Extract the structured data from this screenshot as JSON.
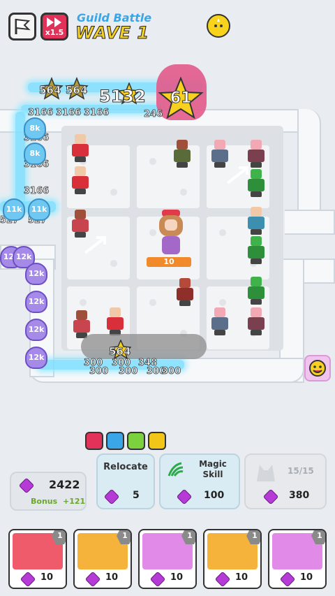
{
  "header": {
    "speed_label": "x1.5",
    "mode_label": "Guild Battle",
    "wave_label": "WAVE 1"
  },
  "boss": {
    "score": "5132",
    "star_value": "61",
    "mini_stars": [
      "564",
      "564"
    ]
  },
  "damage_numbers": {
    "top_row": [
      "3166",
      "3166",
      "3166",
      "246"
    ],
    "left_col": [
      "3166",
      "3166",
      "3166"
    ],
    "lower": [
      "527",
      "527"
    ],
    "bottom_row": [
      "300",
      "300",
      "300",
      "348",
      "300",
      "300",
      "300"
    ],
    "bottom_star": "564"
  },
  "enemies": [
    "12k",
    "12k",
    "12k",
    "12k",
    "12k",
    "12k",
    "11k",
    "11k",
    "8k",
    "8k"
  ],
  "center_unit_level": "10",
  "resources": {
    "gems": "2422",
    "bonus_label": "Bonus",
    "bonus_value": "+121"
  },
  "actions": {
    "relocate": {
      "label": "Relocate",
      "cost": "5"
    },
    "magic_skill": {
      "label": "Magic\nSkill",
      "cost": "100"
    },
    "summon": {
      "count": "15/15",
      "cost": "380"
    }
  },
  "unit_cards": [
    {
      "level": "1",
      "cost": "10",
      "color": "#ef5b6b"
    },
    {
      "level": "1",
      "cost": "10",
      "color": "#f6b33b"
    },
    {
      "level": "1",
      "cost": "10",
      "color": "#e28ae8"
    },
    {
      "level": "1",
      "cost": "10",
      "color": "#f6b33b"
    },
    {
      "level": "1",
      "cost": "10",
      "color": "#e28ae8"
    }
  ],
  "colors": {
    "gem": "#b63ad6",
    "wave": "#f5d027",
    "guild": "#3aa6e8"
  }
}
